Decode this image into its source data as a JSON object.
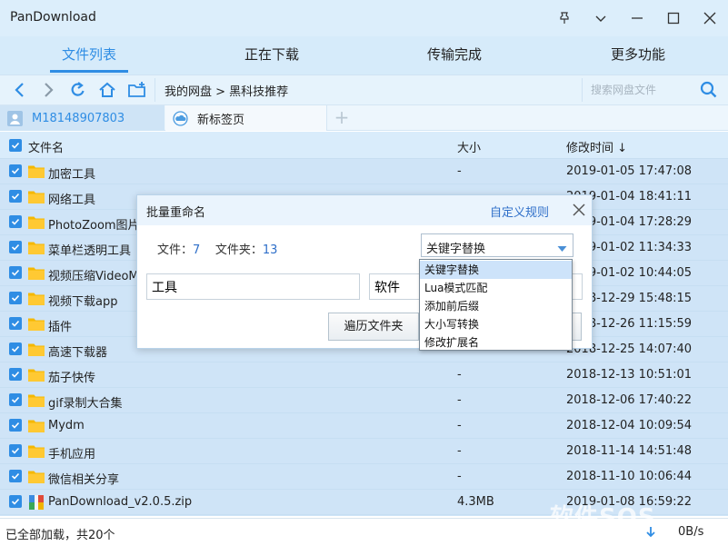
{
  "app": {
    "title": "PanDownload"
  },
  "window": {
    "pin_icon": "pin-icon",
    "menu_icon": "chevron-down-icon",
    "min_icon": "minimize-icon",
    "max_icon": "maximize-icon",
    "close_icon": "close-icon"
  },
  "main_tabs": [
    {
      "label": "文件列表",
      "active": true
    },
    {
      "label": "正在下载",
      "active": false
    },
    {
      "label": "传输完成",
      "active": false
    },
    {
      "label": "更多功能",
      "active": false
    }
  ],
  "toolbar": {
    "breadcrumb": "我的网盘 > 黑科技推荐",
    "search_placeholder": "搜索网盘文件"
  },
  "page_tabs": {
    "user": "M18148907803",
    "new_tab": "新标签页",
    "add": "+"
  },
  "list_header": {
    "name": "文件名",
    "size": "大小",
    "modified": "修改时间 ↓"
  },
  "files": [
    {
      "name": "加密工具",
      "size": "-",
      "modified": "2019-01-05 17:47:08",
      "type": "folder"
    },
    {
      "name": "网络工具",
      "size": "-",
      "modified": "2019-01-04 18:41:11",
      "type": "folder"
    },
    {
      "name": "PhotoZoom图片",
      "size": "",
      "modified": "2019-01-04 17:28:29",
      "type": "folder"
    },
    {
      "name": "菜单栏透明工具",
      "size": "",
      "modified": "2019-01-02 11:34:33",
      "type": "folder"
    },
    {
      "name": "视频压缩VideoM",
      "size": "",
      "modified": "2019-01-02 10:44:05",
      "type": "folder"
    },
    {
      "name": "视频下载app",
      "size": "",
      "modified": "2018-12-29 15:48:15",
      "type": "folder"
    },
    {
      "name": "插件",
      "size": "",
      "modified": "2018-12-26 11:15:59",
      "type": "folder"
    },
    {
      "name": "高速下载器",
      "size": "",
      "modified": "2018-12-25 14:07:40",
      "type": "folder"
    },
    {
      "name": "茄子快传",
      "size": "-",
      "modified": "2018-12-13 10:51:01",
      "type": "folder"
    },
    {
      "name": "gif录制大合集",
      "size": "-",
      "modified": "2018-12-06 17:40:22",
      "type": "folder"
    },
    {
      "name": "Mydm",
      "size": "-",
      "modified": "2018-12-04 10:09:54",
      "type": "folder"
    },
    {
      "name": "手机应用",
      "size": "-",
      "modified": "2018-11-14 14:51:48",
      "type": "folder"
    },
    {
      "name": "微信相关分享",
      "size": "-",
      "modified": "2018-11-10 10:06:44",
      "type": "folder"
    },
    {
      "name": "PanDownload_v2.0.5.zip",
      "size": "4.3MB",
      "modified": "2019-01-08 16:59:22",
      "type": "zip"
    }
  ],
  "status": {
    "text": "已全部加载，共20个",
    "speed": "0B/s",
    "watermark": "软件SOS"
  },
  "dialog": {
    "title": "批量重命名",
    "custom_rules": "自定义规则",
    "files_label": "文件：",
    "files_count": "7",
    "folders_label": "文件夹：",
    "folders_count": "13",
    "mode_selected": "关键字替换",
    "find_value": "工具",
    "replace_value": "软件",
    "browse_button": "遍历文件夹",
    "ok_button": ""
  },
  "dropdown_options": [
    "关键字替换",
    "Lua模式匹配",
    "添加前后缀",
    "大小写转换",
    "修改扩展名"
  ],
  "colors": {
    "accent": "#2f8de4",
    "list_bg": "#cfe4f7",
    "header_bg": "#dceefb"
  }
}
